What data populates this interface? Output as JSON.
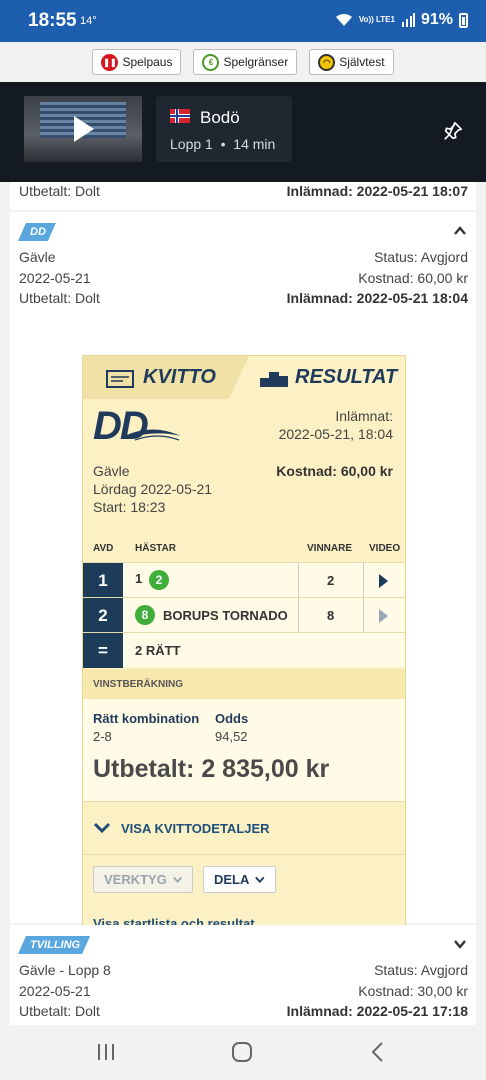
{
  "status_bar": {
    "time": "18:55",
    "temp": "14°",
    "network": "Vo)) LTE1",
    "battery": "91%"
  },
  "rg_bar": {
    "pause": {
      "icon": "pause-icon",
      "label": "Spelpaus"
    },
    "limits": {
      "icon": "limit-icon",
      "label": "Spelgränser"
    },
    "selftest": {
      "icon": "gauge-icon",
      "label": "Självtest"
    }
  },
  "video": {
    "track": "Bodö",
    "race": "Lopp 1",
    "time": "14 min"
  },
  "bet_top": {
    "paid": "Utbetalt: Dolt",
    "submitted": "Inlämnad: 2022-05-21 18:07"
  },
  "bet_dd": {
    "tag": "DD",
    "track": "Gävle",
    "status": "Status: Avgjord",
    "date": "2022-05-21",
    "cost": "Kostnad: 60,00 kr",
    "paid": "Utbetalt: Dolt",
    "submitted": "Inlämnad: 2022-05-21 18:04"
  },
  "receipt": {
    "tab_receipt": "KVITTO",
    "tab_result": "RESULTAT",
    "logo": "DD",
    "submitted_label": "Inlämnat:",
    "submitted_value": "2022-05-21, 18:04",
    "track": "Gävle",
    "day": "Lördag 2022-05-21",
    "start": "Start: 18:23",
    "cost": "Kostnad: 60,00 kr",
    "headers": {
      "avd": "AVD",
      "horses": "HÄSTAR",
      "winner": "VINNARE",
      "video": "VIDEO"
    },
    "rows": [
      {
        "avd": "1",
        "prefix": "1",
        "num": "2",
        "horse": "",
        "winner": "2"
      },
      {
        "avd": "2",
        "prefix": "",
        "num": "8",
        "horse": "BORUPS TORNADO",
        "winner": "8"
      }
    ],
    "total": {
      "sign": "=",
      "text": "2 RÄTT"
    },
    "calc_header": "VINSTBERÄKNING",
    "combo_label": "Rätt kombination",
    "combo_value": "2-8",
    "odds_label": "Odds",
    "odds_value": "94,52",
    "payout": "Utbetalt: 2 835,00 kr",
    "details_link": "VISA KVITTODETALJER",
    "tools_btn": "VERKTYG",
    "share_btn": "DELA",
    "startlist_link": "Visa startlista och resultat"
  },
  "bet_tvilling": {
    "tag": "TVILLING",
    "track": "Gävle - Lopp 8",
    "status": "Status: Avgjord",
    "date": "2022-05-21",
    "cost": "Kostnad: 30,00 kr",
    "paid": "Utbetalt: Dolt",
    "submitted": "Inlämnad: 2022-05-21 17:18"
  },
  "colors": {
    "brand": "#1d5fae",
    "receipt_bg": "#fcf1c4",
    "navy": "#1d3c5a",
    "green": "#3fae3a"
  }
}
